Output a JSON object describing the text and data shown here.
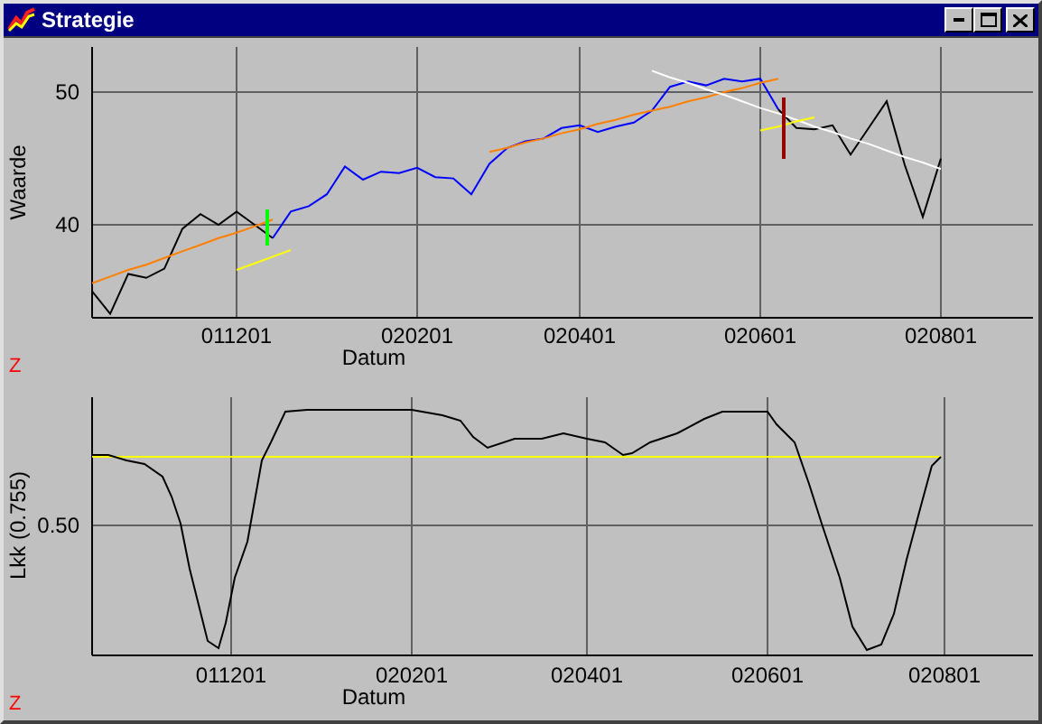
{
  "window": {
    "title": "Strategie"
  },
  "upper_chart": {
    "z_marker": "Z",
    "chart_data": {
      "type": "line",
      "xlabel": "Datum",
      "ylabel": "Waarde",
      "categories": [
        null,
        null,
        null,
        null,
        null,
        null,
        null,
        null,
        "011201",
        null,
        null,
        null,
        null,
        null,
        null,
        null,
        null,
        null,
        "020201",
        null,
        null,
        null,
        null,
        null,
        null,
        null,
        null,
        "020401",
        null,
        null,
        null,
        null,
        null,
        null,
        null,
        null,
        null,
        "020601",
        null,
        null,
        null,
        null,
        null,
        null,
        null,
        null,
        null,
        "020801"
      ],
      "ylim": [
        33,
        53.4
      ],
      "grid": true,
      "yticks": [
        40,
        50
      ],
      "series": [
        {
          "color": "#000000",
          "values": [
            35.0,
            33.3,
            36.3,
            36.0,
            36.7,
            39.7,
            40.8,
            40.0,
            41.0,
            40.0,
            39.0,
            null,
            null,
            null,
            null,
            null,
            null,
            null,
            null,
            null,
            null,
            null,
            null,
            null,
            null,
            null,
            null,
            null,
            null,
            null,
            null,
            null,
            null,
            null,
            null,
            null,
            null,
            null,
            null,
            null,
            null,
            null,
            null,
            null,
            null,
            null,
            null,
            null
          ]
        },
        {
          "color": "#0000ff",
          "values": [
            null,
            null,
            null,
            null,
            null,
            null,
            null,
            null,
            null,
            null,
            39.0,
            41.0,
            41.4,
            42.3,
            44.4,
            43.4,
            44.0,
            43.9,
            44.3,
            43.6,
            43.5,
            42.3,
            44.6,
            45.8,
            46.3,
            46.5,
            47.3,
            47.5,
            47.0,
            47.4,
            47.7,
            48.6,
            50.4,
            50.8,
            50.5,
            51.0,
            50.8,
            51.0,
            48.7,
            null,
            null,
            null,
            null,
            null,
            null,
            null,
            null,
            null
          ]
        },
        {
          "color": "#000000",
          "values": [
            null,
            null,
            null,
            null,
            null,
            null,
            null,
            null,
            null,
            null,
            null,
            null,
            null,
            null,
            null,
            null,
            null,
            null,
            null,
            null,
            null,
            null,
            null,
            null,
            null,
            null,
            null,
            null,
            null,
            null,
            null,
            null,
            null,
            null,
            null,
            null,
            null,
            null,
            48.7,
            47.3,
            47.2,
            47.5,
            45.3,
            47.3,
            49.3,
            44.5,
            40.6,
            45.0
          ]
        },
        {
          "color": "#ff8000",
          "values": [
            35.6,
            36.1,
            36.6,
            37.0,
            37.5,
            38.0,
            38.5,
            39.0,
            39.4,
            39.9,
            40.4,
            null,
            null,
            null,
            null,
            null,
            null,
            null,
            null,
            null,
            null,
            null,
            45.5,
            45.8,
            46.2,
            46.5,
            46.9,
            47.2,
            47.6,
            47.9,
            48.3,
            48.6,
            48.9,
            49.3,
            49.6,
            50.0,
            50.3,
            50.7,
            51.0,
            null,
            null,
            null,
            null,
            null,
            null,
            null,
            null,
            null
          ]
        },
        {
          "color": "#ffffff",
          "values": [
            null,
            null,
            null,
            null,
            null,
            null,
            null,
            null,
            null,
            null,
            null,
            null,
            null,
            null,
            null,
            null,
            null,
            null,
            null,
            null,
            null,
            null,
            null,
            null,
            null,
            null,
            null,
            null,
            null,
            null,
            null,
            51.6,
            51.1,
            50.7,
            50.2,
            49.8,
            49.3,
            48.8,
            48.4,
            47.9,
            47.4,
            47.0,
            46.5,
            46.1,
            45.6,
            45.1,
            44.7,
            44.2
          ]
        },
        {
          "color": "#ffff00",
          "values": [
            null,
            null,
            null,
            null,
            null,
            null,
            null,
            null,
            36.6,
            37.1,
            37.6,
            38.1,
            null,
            null,
            null,
            null,
            null,
            null,
            null,
            null,
            null,
            null,
            null,
            null,
            null,
            null,
            null,
            null,
            null,
            null,
            null,
            null,
            null,
            null,
            null,
            null,
            null,
            47.1,
            47.4,
            47.8,
            48.1,
            null,
            null,
            null,
            null,
            null,
            null,
            null
          ]
        }
      ]
    }
  },
  "lower_chart": {
    "ylabel": "Lkk (0.755)",
    "ytick": "0.50",
    "xticks": [
      "011201",
      "020201",
      "020401",
      "020601",
      "020801"
    ],
    "xlabel": "Datum",
    "z_marker": "Z"
  }
}
